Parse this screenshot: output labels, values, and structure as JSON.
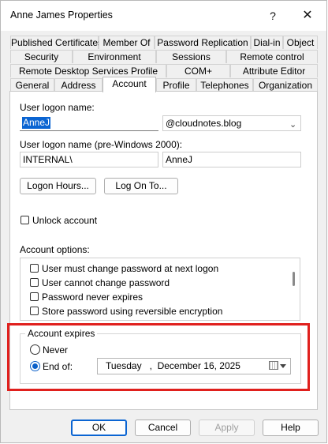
{
  "window": {
    "title": "Anne James Properties",
    "help_glyph": "?",
    "close_glyph": "✕"
  },
  "tabs": {
    "row1": [
      "Published Certificates",
      "Member Of",
      "Password Replication",
      "Dial-in",
      "Object"
    ],
    "row2": [
      "Security",
      "Environment",
      "Sessions",
      "Remote control"
    ],
    "row3": [
      "Remote Desktop Services Profile",
      "COM+",
      "Attribute Editor"
    ],
    "row4": [
      "General",
      "Address",
      "Account",
      "Profile",
      "Telephones",
      "Organization"
    ],
    "active": "Account"
  },
  "account": {
    "logon_name_label": "User logon name:",
    "logon_name_value": "AnneJ",
    "domain_suffix": "@cloudnotes.blog",
    "pre2000_label": "User logon name (pre-Windows 2000):",
    "pre2000_domain": "INTERNAL\\",
    "pre2000_name": "AnneJ",
    "logon_hours_button": "Logon Hours...",
    "logon_to_button": "Log On To...",
    "unlock_label": "Unlock account",
    "options_label": "Account options:",
    "options": [
      "User must change password at next logon",
      "User cannot change password",
      "Password never expires",
      "Store password using reversible encryption"
    ],
    "expires_title": "Account expires",
    "never_label": "Never",
    "end_of_label": "End of:",
    "end_of_date": "Tuesday   ,  December 16, 2025",
    "end_of_selected": true
  },
  "footer": {
    "ok": "OK",
    "cancel": "Cancel",
    "apply": "Apply",
    "help": "Help"
  },
  "colors": {
    "accent": "#0a64d2",
    "highlight": "#e0201d"
  }
}
